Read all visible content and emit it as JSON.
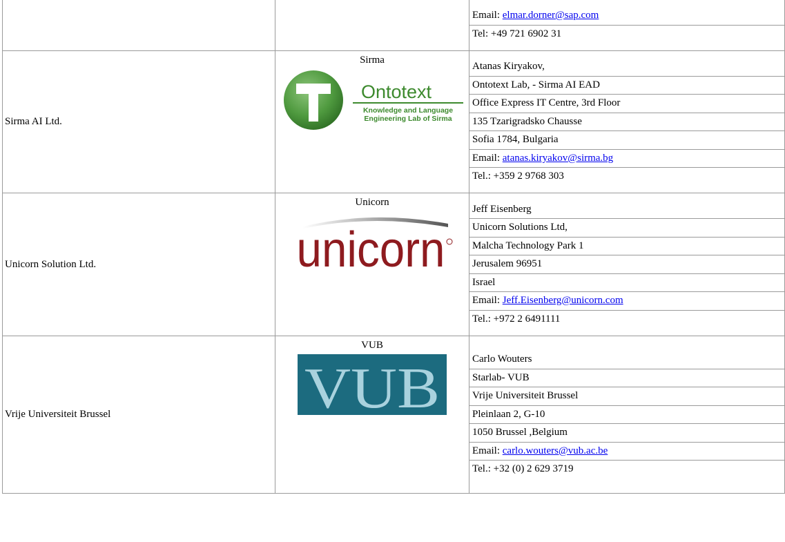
{
  "rows": [
    {
      "partner": "",
      "logo_name": "",
      "contact": [
        {
          "pre": "Email: ",
          "email": "elmar.dorner@sap.com"
        },
        {
          "text": "Tel: +49 721 6902 31"
        }
      ]
    },
    {
      "partner": "Sirma AI Ltd.",
      "logo_name": "Sirma",
      "logo": {
        "main": "Ontotext",
        "sub1": "Knowledge and Language",
        "sub2": "Engineering Lab of Sirma"
      },
      "contact": [
        {
          "text": "Atanas Kiryakov,"
        },
        {
          "text": "Ontotext Lab, - Sirma AI EAD"
        },
        {
          "text": "Office Express IT Centre, 3rd Floor"
        },
        {
          "text": "135 Tzarigradsko Chausse"
        },
        {
          "text": "Sofia 1784, Bulgaria"
        },
        {
          "pre": "Email: ",
          "email": "atanas.kiryakov@sirma.bg"
        },
        {
          "text": "Tel.: +359 2 9768 303"
        }
      ]
    },
    {
      "partner": "Unicorn Solution Ltd.",
      "logo_name": "Unicorn",
      "logo": {
        "main": "unicorn"
      },
      "contact": [
        {
          "text": "Jeff Eisenberg"
        },
        {
          "text": "Unicorn Solutions Ltd,"
        },
        {
          "text": "Malcha Technology Park 1"
        },
        {
          "text": "Jerusalem 96951"
        },
        {
          "text": "Israel"
        },
        {
          "pre": "Email: ",
          "email": "Jeff.Eisenberg@unicorn.com"
        },
        {
          "text": "Tel.: +972 2 6491111"
        }
      ]
    },
    {
      "partner": "Vrije Universiteit Brussel",
      "logo_name": "VUB",
      "logo": {
        "main": "VUB"
      },
      "contact": [
        {
          "text": "Carlo Wouters"
        },
        {
          "text": "Starlab- VUB"
        },
        {
          "text": "Vrije Universiteit Brussel"
        },
        {
          "text": "Pleinlaan 2, G-10"
        },
        {
          "text": "1050 Brussel ,Belgium"
        },
        {
          "pre": "Email: ",
          "email": "carlo.wouters@vub.ac.be"
        },
        {
          "text": "Tel.: +32 (0) 2 629 3719"
        }
      ]
    }
  ],
  "colors": {
    "link": "#0000ee",
    "border": "#9a9a9a",
    "ontotext_green": "#3d8a2e",
    "unicorn_red": "#8e1b1f",
    "vub_blue": "#1c6b7f"
  }
}
